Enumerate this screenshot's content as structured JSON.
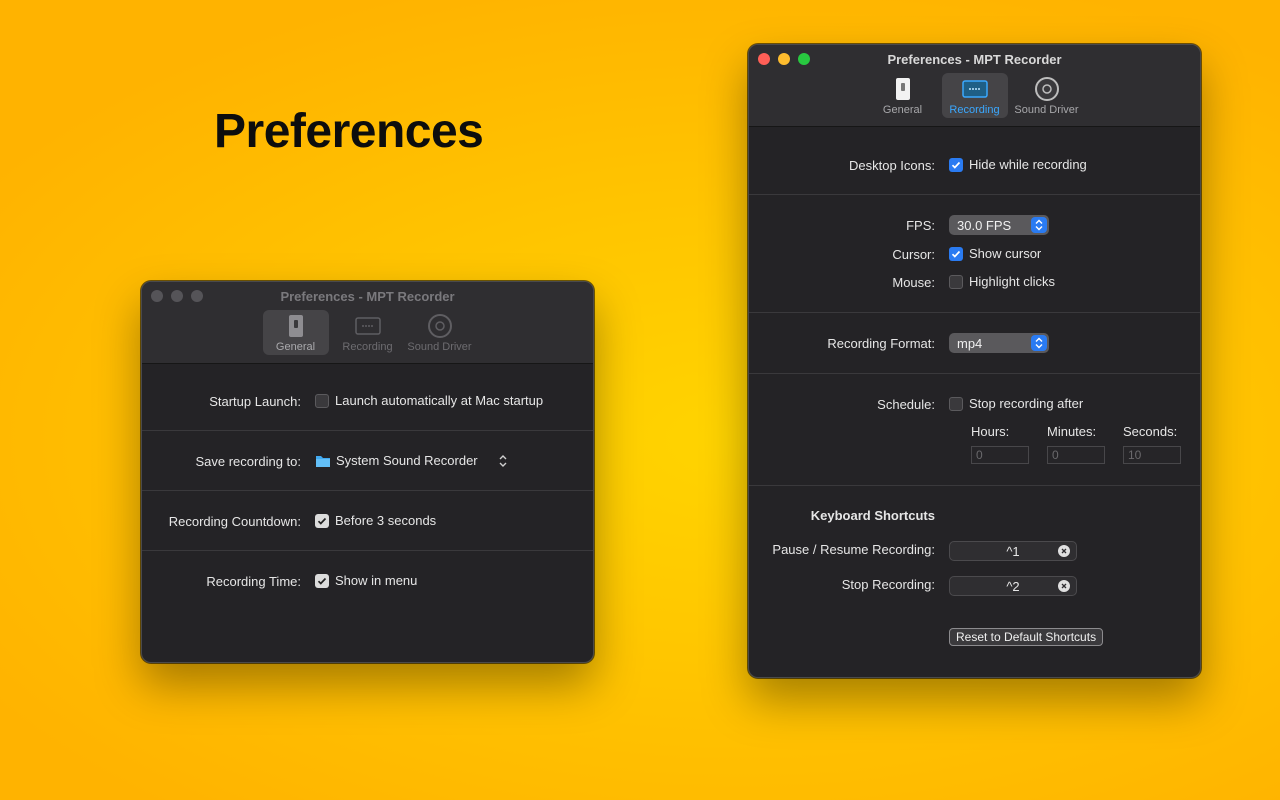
{
  "headline": "Preferences",
  "window_general": {
    "title": "Preferences - MPT Recorder",
    "tabs": [
      {
        "label": "General",
        "icon": "switch-icon",
        "active": true
      },
      {
        "label": "Recording",
        "icon": "screen-icon",
        "active": false
      },
      {
        "label": "Sound Driver",
        "icon": "disc-icon",
        "active": false
      }
    ],
    "startup_launch": {
      "label": "Startup Launch:",
      "option": "Launch automatically at Mac startup",
      "checked": false
    },
    "save_to": {
      "label": "Save recording to:",
      "value": "System Sound Recorder",
      "icon": "folder-icon"
    },
    "countdown": {
      "label": "Recording Countdown:",
      "option": "Before 3 seconds",
      "checked": true
    },
    "recording_time": {
      "label": "Recording Time:",
      "option": "Show in menu",
      "checked": true
    }
  },
  "window_recording": {
    "title": "Preferences - MPT Recorder",
    "tabs": [
      {
        "label": "General",
        "icon": "switch-icon",
        "active": false
      },
      {
        "label": "Recording",
        "icon": "screen-icon",
        "active": true
      },
      {
        "label": "Sound Driver",
        "icon": "disc-icon",
        "active": false
      }
    ],
    "desktop_icons": {
      "label": "Desktop Icons:",
      "option": "Hide while recording",
      "checked": true
    },
    "fps": {
      "label": "FPS:",
      "value": "30.0 FPS"
    },
    "cursor": {
      "label": "Cursor:",
      "option": "Show cursor",
      "checked": true
    },
    "mouse": {
      "label": "Mouse:",
      "option": "Highlight clicks",
      "checked": false
    },
    "format": {
      "label": "Recording Format:",
      "value": "mp4"
    },
    "schedule": {
      "label": "Schedule:",
      "option": "Stop recording after",
      "checked": false,
      "hours_label": "Hours:",
      "hours": "0",
      "minutes_label": "Minutes:",
      "minutes": "0",
      "seconds_label": "Seconds:",
      "seconds": "10"
    },
    "shortcuts": {
      "heading": "Keyboard Shortcuts",
      "pause_label": "Pause / Resume Recording:",
      "pause_key": "^1",
      "stop_label": "Stop Recording:",
      "stop_key": "^2",
      "reset_button": "Reset to Default Shortcuts"
    }
  },
  "colors": {
    "accent": "#2a7bf2",
    "window_bg": "#242326",
    "background": "#ffc600"
  }
}
